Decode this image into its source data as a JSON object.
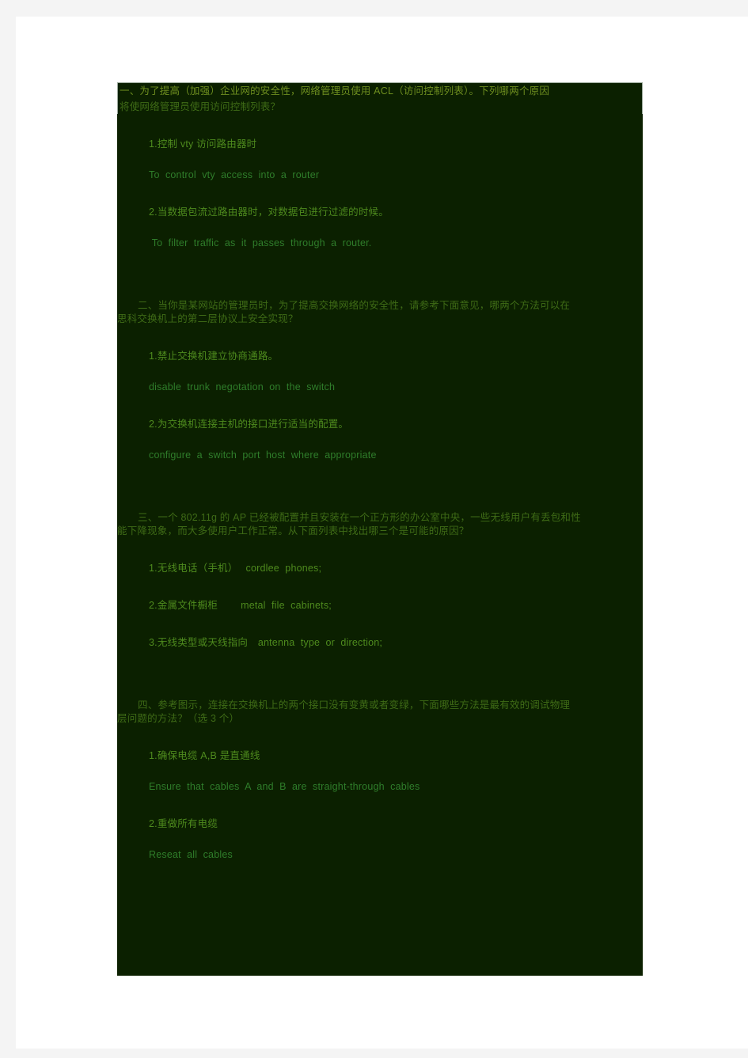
{
  "document": {
    "page_background": "#ffffff",
    "viewport_background": "#f4f4f4",
    "content_background": "#0b2000",
    "colors": {
      "heading_green": "#6f8f1f",
      "body_green": "#3f6b16",
      "item_green": "#4e8a1d",
      "english_green": "#2f7d2a"
    }
  },
  "questions": [
    {
      "number": "一、",
      "prompt_line1": "一、为了提高（加强）企业网的安全性，网络管理员使用 ACL（访问控制列表）。下列哪两个原因",
      "prompt_line2": "将使网络管理员使用访问控制列表？",
      "answers": [
        {
          "cn": "1.控制 vty 访问路由器时",
          "en": "To  control  vty  access  into  a  router"
        },
        {
          "cn": "2.当数据包流过路由器时，对数据包进行过滤的时候。",
          "en": " To  filter  traffic  as  it  passes  through  a  router."
        }
      ]
    },
    {
      "number": "二、",
      "prompt_line1": "二、当你是某网站的管理员时，为了提高交换网络的安全性，请参考下面意见，哪两个方法可以在",
      "prompt_line2": "思科交换机上的第二层协议上安全实现？",
      "answers": [
        {
          "cn": "1.禁止交换机建立协商通路。",
          "en": "disable  trunk  negotation  on  the  switch"
        },
        {
          "cn": "2.为交换机连接主机的接口进行适当的配置。",
          "en": "configure  a  switch  port  host  where  appropriate"
        }
      ]
    },
    {
      "number": "三、",
      "prompt_line1": "三、一个 802.11g 的 AP 已经被配置并且安装在一个正方形的办公室中央，一些无线用户有丢包和性",
      "prompt_line2": "能下降现象，而大多使用户工作正常。从下面列表中找出哪三个是可能的原因？",
      "answers": [
        {
          "cn": "1.无线电话（手机）　 cordlee  phones;",
          "en": ""
        },
        {
          "cn": "2.金属文件橱柜　　 metal  file  cabinets;",
          "en": ""
        },
        {
          "cn": "3.无线类型或天线指向　antenna  type  or  direction;",
          "en": ""
        }
      ]
    },
    {
      "number": "四、",
      "prompt_line1": "四、参考图示，连接在交换机上的两个接口没有变黄或者变绿，下面哪些方法是最有效的调试物理",
      "prompt_line2": "层问题的方法？（选 3 个）",
      "answers": [
        {
          "cn": "1.确保电缆 A,B 是直通线",
          "en": "Ensure  that  cables  A  and  B  are  straight-through  cables"
        },
        {
          "cn": "2.重做所有电缆",
          "en": "Reseat  all  cables"
        }
      ]
    }
  ]
}
